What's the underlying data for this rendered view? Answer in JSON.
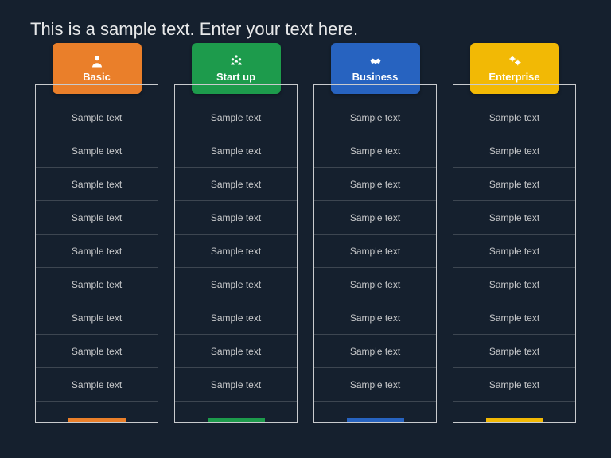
{
  "title": "This is a sample text. Enter your text here.",
  "plans": [
    {
      "name": "Basic",
      "color": "#ea7f2a",
      "icon": "person-icon",
      "rows": [
        "Sample text",
        "Sample text",
        "Sample text",
        "Sample text",
        "Sample text",
        "Sample text",
        "Sample text",
        "Sample text",
        "Sample text"
      ]
    },
    {
      "name": "Start up",
      "color": "#1d9b4c",
      "icon": "group-icon",
      "rows": [
        "Sample text",
        "Sample text",
        "Sample text",
        "Sample text",
        "Sample text",
        "Sample text",
        "Sample text",
        "Sample text",
        "Sample text"
      ]
    },
    {
      "name": "Business",
      "color": "#2763c0",
      "icon": "handshake-icon",
      "rows": [
        "Sample text",
        "Sample text",
        "Sample text",
        "Sample text",
        "Sample text",
        "Sample text",
        "Sample text",
        "Sample text",
        "Sample text"
      ]
    },
    {
      "name": "Enterprise",
      "color": "#f2b905",
      "icon": "gears-icon",
      "rows": [
        "Sample text",
        "Sample text",
        "Sample text",
        "Sample text",
        "Sample text",
        "Sample text",
        "Sample text",
        "Sample text",
        "Sample text"
      ]
    }
  ]
}
